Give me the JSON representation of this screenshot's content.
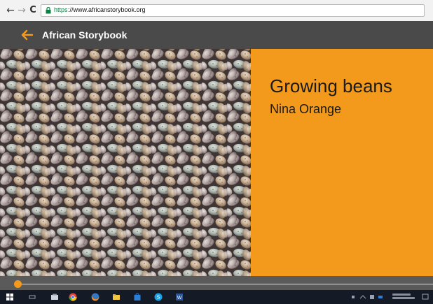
{
  "browser": {
    "url_secure": "https",
    "url_host": "://www.africanstorybook.org",
    "back_glyph": "←",
    "forward_glyph": "→",
    "reload_glyph": "C"
  },
  "app": {
    "title": "African Storybook",
    "accent_color": "#f39a1c",
    "header_color": "#4a4a4a"
  },
  "story": {
    "title": "Growing beans",
    "author": "Nina Orange",
    "cover_image": "beans-photo"
  },
  "reader": {
    "progress": 0
  },
  "taskbar": {
    "icons": [
      "start-icon",
      "search-icon",
      "task-view-icon",
      "chrome-icon",
      "firefox-icon",
      "file-explorer-icon",
      "store-icon",
      "skype-icon",
      "word-icon"
    ]
  }
}
